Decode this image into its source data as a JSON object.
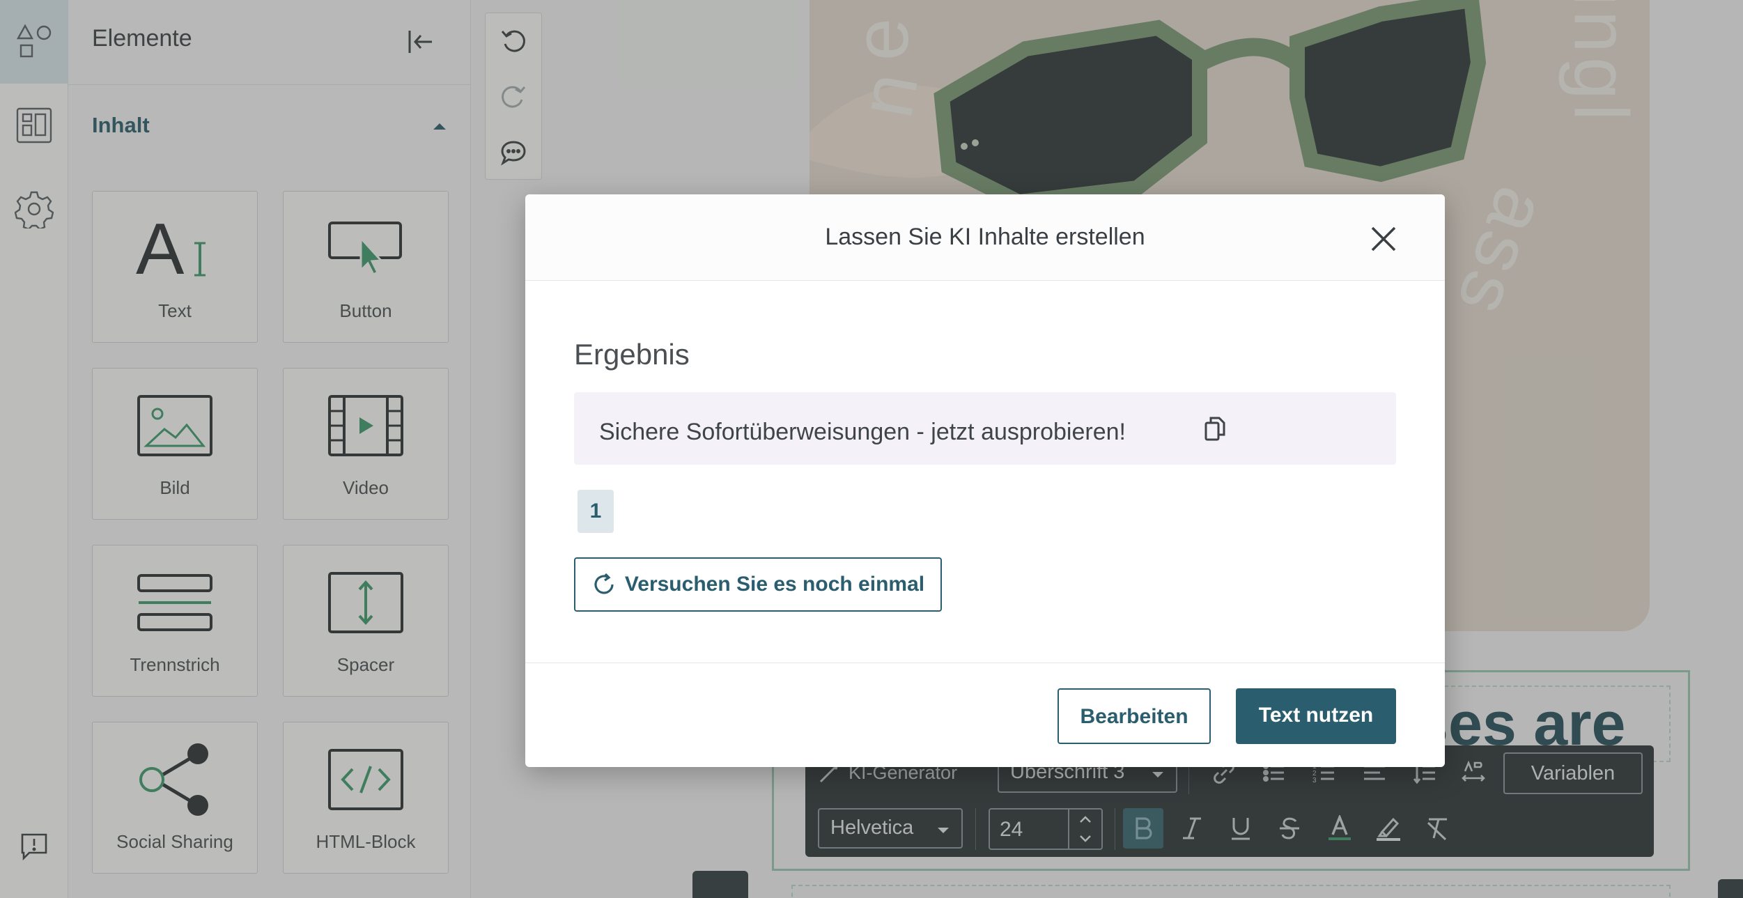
{
  "sidebar": {
    "title": "Elemente",
    "section": "Inhalt",
    "tiles": [
      {
        "label": "Text",
        "icon": "text-icon"
      },
      {
        "label": "Button",
        "icon": "button-icon"
      },
      {
        "label": "Bild",
        "icon": "image-icon"
      },
      {
        "label": "Video",
        "icon": "video-icon"
      },
      {
        "label": "Trennstrich",
        "icon": "divider-icon"
      },
      {
        "label": "Spacer",
        "icon": "spacer-icon"
      },
      {
        "label": "Social Sharing",
        "icon": "share-icon"
      },
      {
        "label": "HTML-Block",
        "icon": "code-icon"
      }
    ]
  },
  "canvas": {
    "heading_fragment": "ses are"
  },
  "toolbar": {
    "ki_label": "KI-Generator",
    "style_select": "Überschrift 3",
    "variables_label": "Variablen",
    "font_select": "Helvetica",
    "font_size": "24"
  },
  "modal": {
    "title": "Lassen Sie KI Inhalte erstellen",
    "result_heading": "Ergebnis",
    "result_text": "Sichere Sofortüberweisungen - jetzt ausprobieren!",
    "page": "1",
    "retry_label": "Versuchen Sie es noch einmal",
    "edit_label": "Bearbeiten",
    "use_label": "Text nutzen"
  },
  "colors": {
    "brand": "#2a5d6e",
    "accent_green": "#3d9a6e",
    "toolbar_bg": "#2c3338",
    "result_bg": "#f4f1f8"
  }
}
